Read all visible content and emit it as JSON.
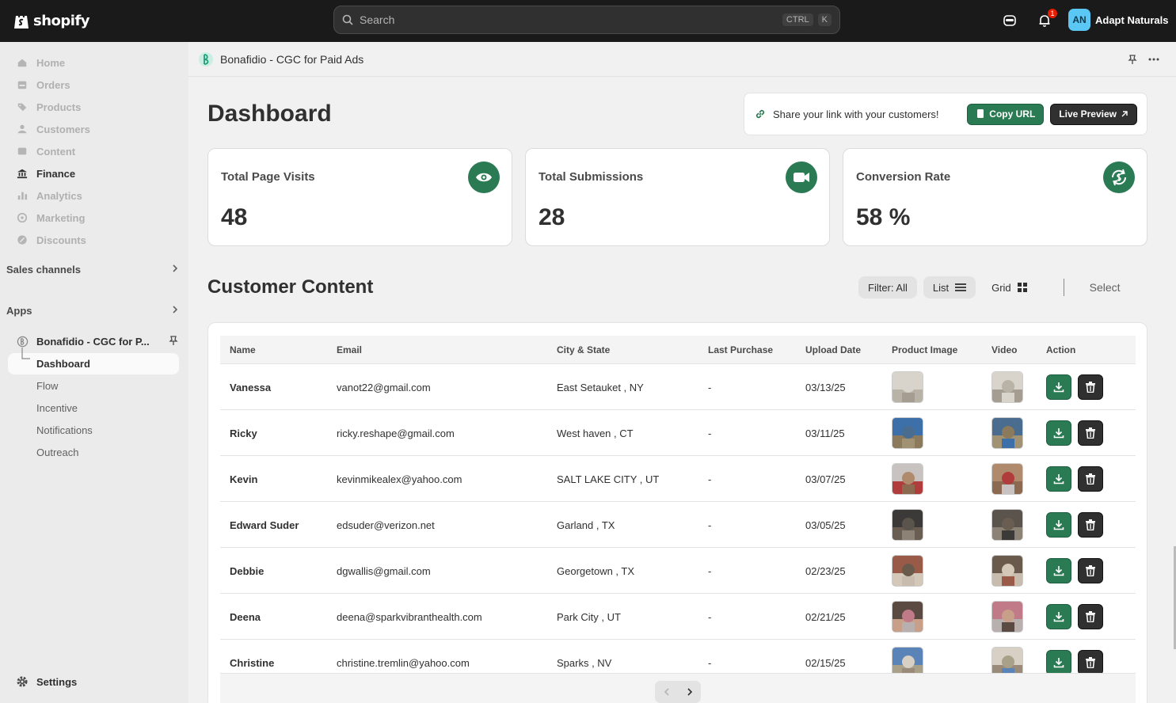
{
  "topbar": {
    "logo_text": "shopify",
    "search_placeholder": "Search",
    "shortcut_ctrl": "CTRL",
    "shortcut_k": "K",
    "notification_count": "1",
    "avatar_initials": "AN",
    "store_name": "Adapt Naturals"
  },
  "sidebar": {
    "items": [
      {
        "label": "Home",
        "icon": "home-icon",
        "active": false
      },
      {
        "label": "Orders",
        "icon": "orders-icon",
        "active": false
      },
      {
        "label": "Products",
        "icon": "tag-icon",
        "active": false
      },
      {
        "label": "Customers",
        "icon": "person-icon",
        "active": false
      },
      {
        "label": "Content",
        "icon": "content-icon",
        "active": false
      },
      {
        "label": "Finance",
        "icon": "bank-icon",
        "active": true
      },
      {
        "label": "Analytics",
        "icon": "bar-chart-icon",
        "active": false
      },
      {
        "label": "Marketing",
        "icon": "target-icon",
        "active": false
      },
      {
        "label": "Discounts",
        "icon": "discount-icon",
        "active": false
      }
    ],
    "sales_channels": "Sales channels",
    "apps": "Apps",
    "app_name": "Bonafidio - CGC for P...",
    "sub_items": [
      "Dashboard",
      "Flow",
      "Incentive",
      "Notifications",
      "Outreach"
    ],
    "settings": "Settings"
  },
  "appbar": {
    "title": "Bonafidio - CGC for Paid Ads"
  },
  "dashboard": {
    "title": "Dashboard",
    "share_text": "Share your link with your customers!",
    "copy_url": "Copy URL",
    "live_preview": "Live Preview"
  },
  "stats": [
    {
      "label": "Total Page Visits",
      "value": "48",
      "icon": "eye-icon"
    },
    {
      "label": "Total Submissions",
      "value": "28",
      "icon": "video-camera-icon"
    },
    {
      "label": "Conversion Rate",
      "value": "58 %",
      "icon": "dollar-cycle-icon"
    }
  ],
  "customer_content": {
    "title": "Customer Content",
    "filter": "Filter: All",
    "list": "List",
    "grid": "Grid",
    "select": "Select"
  },
  "table": {
    "headers": [
      "Name",
      "Email",
      "City & State",
      "Last Purchase",
      "Upload Date",
      "Product Image",
      "Video",
      "Action"
    ],
    "rows": [
      {
        "name": "Vanessa",
        "email": "vanot22@gmail.com",
        "city": "East Setauket , NY",
        "last": "-",
        "date": "03/13/25"
      },
      {
        "name": "Ricky",
        "email": "ricky.reshape@gmail.com",
        "city": "West haven , CT",
        "last": "-",
        "date": "03/11/25"
      },
      {
        "name": "Kevin",
        "email": "kevinmikealex@yahoo.com",
        "city": "SALT LAKE CITY , UT",
        "last": "-",
        "date": "03/07/25"
      },
      {
        "name": "Edward Suder",
        "email": "edsuder@verizon.net",
        "city": "Garland , TX",
        "last": "-",
        "date": "03/05/25"
      },
      {
        "name": "Debbie",
        "email": "dgwallis@gmail.com",
        "city": "Georgetown , TX",
        "last": "-",
        "date": "02/23/25"
      },
      {
        "name": "Deena",
        "email": "deena@sparkvibranthealth.com",
        "city": "Park City , UT",
        "last": "-",
        "date": "02/21/25"
      },
      {
        "name": "Christine",
        "email": "christine.tremlin@yahoo.com",
        "city": "Sparks , NV",
        "last": "-",
        "date": "02/15/25"
      }
    ]
  },
  "colors": {
    "accent_green": "#2a7a53",
    "dark": "#303030",
    "topbar": "#1a1a1a"
  }
}
